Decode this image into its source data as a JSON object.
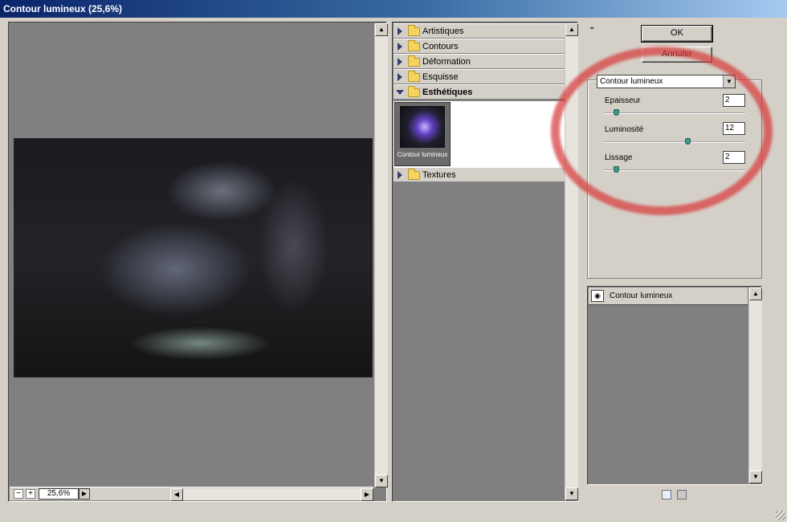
{
  "window": {
    "title": "Contour lumineux (25,6%)"
  },
  "preview": {
    "zoom": "25,6%"
  },
  "filters": {
    "categories": [
      {
        "label": "Artistiques",
        "expanded": false
      },
      {
        "label": "Contours",
        "expanded": false
      },
      {
        "label": "Déformation",
        "expanded": false
      },
      {
        "label": "Esquisse",
        "expanded": false
      },
      {
        "label": "Esthétiques",
        "expanded": true
      },
      {
        "label": "Textures",
        "expanded": false
      }
    ],
    "thumbnail_label": "Contour lumineux"
  },
  "buttons": {
    "ok": "OK",
    "cancel": "Annuler"
  },
  "options": {
    "selected_filter": "Contour lumineux",
    "params": [
      {
        "label": "Epaisseur",
        "value": "2",
        "level": 0.07
      },
      {
        "label": "Luminosité",
        "value": "12",
        "level": 0.6
      },
      {
        "label": "Lissage",
        "value": "2",
        "level": 0.07
      }
    ]
  },
  "layers": {
    "items": [
      {
        "label": "Contour lumineux"
      }
    ]
  },
  "colors": {
    "highlight_ring": "#d73c3c",
    "titlebar": "#0a246a"
  }
}
